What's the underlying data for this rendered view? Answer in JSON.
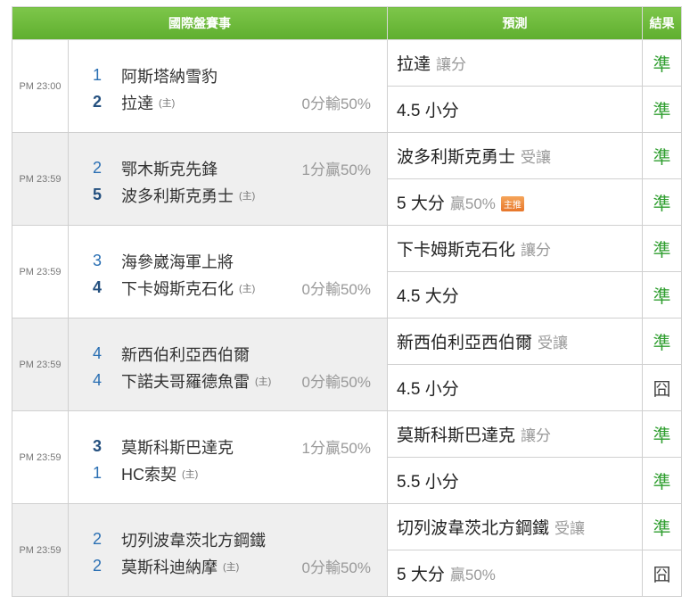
{
  "header": {
    "matches": "國際盤賽事",
    "prediction": "預測",
    "result": "結果"
  },
  "games": [
    {
      "time": "PM 23:00",
      "team1_num": "1",
      "team1": "阿斯塔納雪豹",
      "team1_home": "",
      "team2_num": "2",
      "team2_num_bold": true,
      "team2": "拉達",
      "team2_home": "(主)",
      "hcap": "0分輸50%",
      "hcap_row": 2,
      "preds": [
        {
          "main": "拉達",
          "extra": "讓分",
          "tag": "",
          "result": "準",
          "ok": true
        },
        {
          "main": "4.5 小分",
          "extra": "",
          "tag": "",
          "result": "準",
          "ok": true
        }
      ]
    },
    {
      "time": "PM 23:59",
      "team1_num": "2",
      "team1": "鄂木斯克先鋒",
      "team1_home": "",
      "team2_num": "5",
      "team2_num_bold": true,
      "team2": "波多利斯克勇士",
      "team2_home": "(主)",
      "hcap": "1分贏50%",
      "hcap_row": 1,
      "preds": [
        {
          "main": "波多利斯克勇士",
          "extra": "受讓",
          "tag": "",
          "result": "準",
          "ok": true
        },
        {
          "main": "5 大分",
          "extra": "贏50%",
          "tag": "主推",
          "result": "準",
          "ok": true
        }
      ]
    },
    {
      "time": "PM 23:59",
      "team1_num": "3",
      "team1": "海參崴海軍上將",
      "team1_home": "",
      "team2_num": "4",
      "team2_num_bold": true,
      "team2": "下卡姆斯克石化",
      "team2_home": "(主)",
      "hcap": "0分輸50%",
      "hcap_row": 2,
      "preds": [
        {
          "main": "下卡姆斯克石化",
          "extra": "讓分",
          "tag": "",
          "result": "準",
          "ok": true
        },
        {
          "main": "4.5 大分",
          "extra": "",
          "tag": "",
          "result": "準",
          "ok": true
        }
      ]
    },
    {
      "time": "PM 23:59",
      "team1_num": "4",
      "team1": "新西伯利亞西伯爾",
      "team1_home": "",
      "team2_num": "4",
      "team2_num_bold": false,
      "team2": "下諾夫哥羅德魚雷",
      "team2_home": "(主)",
      "hcap": "0分輸50%",
      "hcap_row": 2,
      "preds": [
        {
          "main": "新西伯利亞西伯爾",
          "extra": "受讓",
          "tag": "",
          "result": "準",
          "ok": true
        },
        {
          "main": "4.5 小分",
          "extra": "",
          "tag": "",
          "result": "囧",
          "ok": false
        }
      ]
    },
    {
      "time": "PM 23:59",
      "team1_num": "3",
      "team1_num_bold": true,
      "team1": "莫斯科斯巴達克",
      "team1_home": "",
      "team2_num": "1",
      "team2_num_bold": false,
      "team2": "HC索契",
      "team2_home": "(主)",
      "hcap": "1分贏50%",
      "hcap_row": 1,
      "preds": [
        {
          "main": "莫斯科斯巴達克",
          "extra": "讓分",
          "tag": "",
          "result": "準",
          "ok": true
        },
        {
          "main": "5.5 小分",
          "extra": "",
          "tag": "",
          "result": "準",
          "ok": true
        }
      ]
    },
    {
      "time": "PM 23:59",
      "team1_num": "2",
      "team1": "切列波韋茨北方鋼鐵",
      "team1_home": "",
      "team2_num": "2",
      "team2_num_bold": false,
      "team2": "莫斯科迪納摩",
      "team2_home": "(主)",
      "hcap": "0分輸50%",
      "hcap_row": 2,
      "preds": [
        {
          "main": "切列波韋茨北方鋼鐵",
          "extra": "受讓",
          "tag": "",
          "result": "準",
          "ok": true
        },
        {
          "main": "5 大分",
          "extra": "贏50%",
          "tag": "",
          "result": "囧",
          "ok": false
        }
      ]
    }
  ]
}
